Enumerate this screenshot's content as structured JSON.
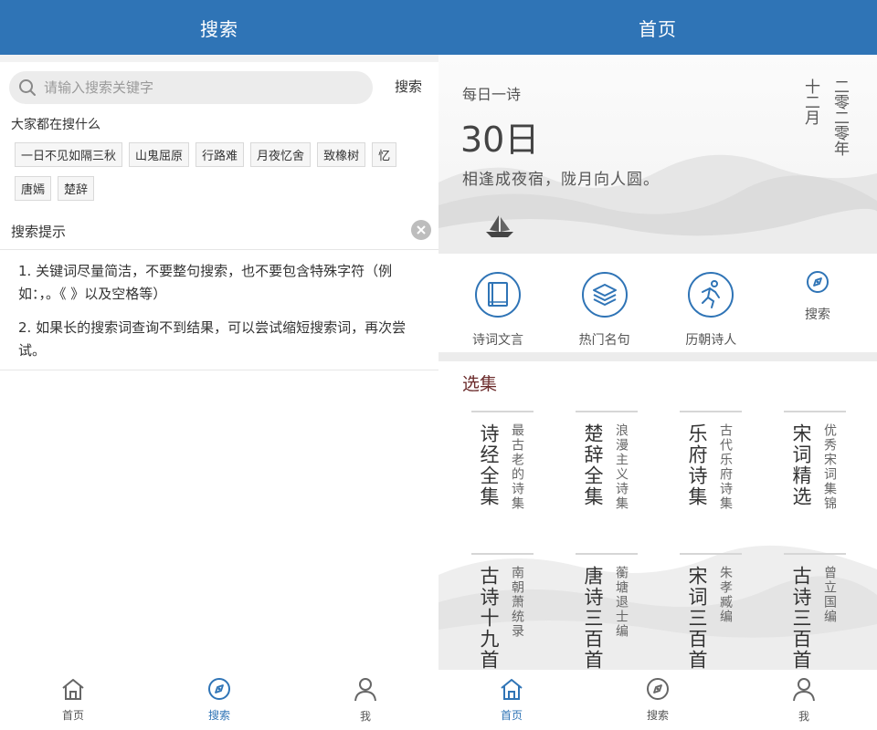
{
  "left": {
    "title": "搜索",
    "search": {
      "placeholder": "请输入搜索关键字",
      "button": "搜索"
    },
    "hot_title": "大家都在搜什么",
    "hot_tags": [
      "一日不见如隔三秋",
      "山鬼屈原",
      "行路难",
      "月夜忆舍",
      "致橡树",
      "忆",
      "唐嫣",
      "楚辞"
    ],
    "tips_title": "搜索提示",
    "tips": [
      "1. 关键词尽量简洁，不要整句搜索，也不要包含特殊字符（例如：，。《 》以及空格等）",
      "2. 如果长的搜索词查询不到结果，可以尝试缩短搜索词，再次尝试。"
    ],
    "tabs": [
      {
        "label": "首页",
        "icon": "home-icon",
        "active": false
      },
      {
        "label": "搜索",
        "icon": "compass-icon",
        "active": true
      },
      {
        "label": "我",
        "icon": "user-icon",
        "active": false
      }
    ]
  },
  "right": {
    "title": "首页",
    "daily": {
      "label": "每日一诗",
      "day": "30日",
      "line": "相逢成夜宿，陇月向人圆。",
      "month": "十二月",
      "year": "二零二零年"
    },
    "quick_links": [
      {
        "label": "诗词文言",
        "icon": "book-icon"
      },
      {
        "label": "热门名句",
        "icon": "layers-icon"
      },
      {
        "label": "历朝诗人",
        "icon": "runner-icon"
      },
      {
        "label": "搜索",
        "icon": "compass-icon"
      }
    ],
    "collections_title": "选集",
    "collections": [
      {
        "name": "诗经全集",
        "desc": "最古老的诗集"
      },
      {
        "name": "楚辞全集",
        "desc": "浪漫主义诗集"
      },
      {
        "name": "乐府诗集",
        "desc": "古代乐府诗集"
      },
      {
        "name": "宋词精选",
        "desc": "优秀宋词集锦"
      },
      {
        "name": "古诗十九首",
        "desc": "南朝萧统录"
      },
      {
        "name": "唐诗三百首",
        "desc": "蘅塘退士编"
      },
      {
        "name": "宋词三百首",
        "desc": "朱孝臧编"
      },
      {
        "name": "古诗三百首",
        "desc": "曾立国编"
      }
    ],
    "tabs": [
      {
        "label": "首页",
        "icon": "home-icon",
        "active": true
      },
      {
        "label": "搜索",
        "icon": "compass-icon",
        "active": false
      },
      {
        "label": "我",
        "icon": "user-icon",
        "active": false
      }
    ]
  },
  "colors": {
    "primary": "#2f74b6",
    "collection_title": "#6b2b2b",
    "tag_border": "#d9d9d9"
  }
}
